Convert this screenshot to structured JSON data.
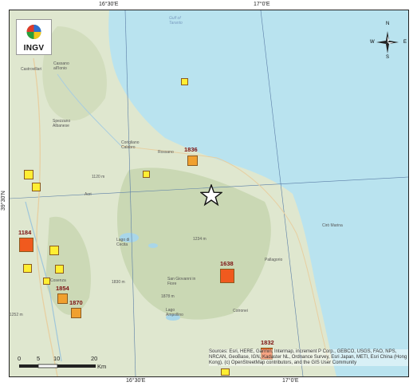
{
  "map": {
    "top_ticks": [
      "16°30'E",
      "17°0'E"
    ],
    "bottom_ticks": [
      "16°30'E",
      "17°0'E"
    ],
    "left_ticks": [
      "39°30'N"
    ]
  },
  "logo": {
    "text": "INGV"
  },
  "compass": {
    "n": "N",
    "s": "S",
    "e": "E",
    "w": "W"
  },
  "places": {
    "gulf": "Gulf of Taranto",
    "castrovillari": "Castrovillari",
    "cassano": "Cassano all'Ionio",
    "spezzano": "Spezzano Albanese",
    "corigliano": "Corigliano Calabro",
    "rossano": "Rossano",
    "acri": "Acri",
    "lago_cecita": "Lago di Cecita",
    "san_giovanni": "San Giovanni in Fiore",
    "cosenza": "Cosenza",
    "ciro_marina": "Cirò Marina",
    "pallagorio": "Pallagorio",
    "cotronei": "Cotronei",
    "ampollino": "Lago Ampollino",
    "elev_1120": "1120 m",
    "elev_1234": "1234 m",
    "elev_1830": "1830 m",
    "elev_1878": "1878 m",
    "elev_1252": "1252 m"
  },
  "earthquakes": [
    {
      "year": "1836",
      "color": "#f0a030"
    },
    {
      "year": "1184",
      "color": "#f05a1e"
    },
    {
      "year": "1638",
      "color": "#f05a1e"
    },
    {
      "year": "1854",
      "color": "#f0a030"
    },
    {
      "year": "1870",
      "color": "#f0a030"
    },
    {
      "year": "1832",
      "color": "#f05a1e"
    },
    {
      "year": "",
      "color": "#ffee33"
    },
    {
      "year": "",
      "color": "#ffee33"
    },
    {
      "year": "",
      "color": "#ffee33"
    },
    {
      "year": "",
      "color": "#ffee33"
    },
    {
      "year": "",
      "color": "#ffee33"
    },
    {
      "year": "",
      "color": "#ffee33"
    },
    {
      "year": "",
      "color": "#ffee33"
    },
    {
      "year": "",
      "color": "#ffee33"
    },
    {
      "year": "",
      "color": "#ffee33"
    }
  ],
  "scale": {
    "ticks": [
      "0",
      "5",
      "10",
      "20"
    ],
    "unit": "Km"
  },
  "attribution": "Sources: Esri, HERE, Garmin, Intermap, increment P Corp., GEBCO, USGS, FAO, NPS, NRCAN, GeoBase, IGN, Kadaster NL, Ordnance Survey, Esri Japan, METI, Esri China (Hong Kong), (c) OpenStreetMap contributors, and the GIS User Community",
  "colors": {
    "sea": "#b9e3ef",
    "land": "#dfe7cf",
    "highland": "#cad8b4",
    "major_quake": "#f05a1e",
    "medium_quake": "#f0a030",
    "minor_quake": "#ffee33"
  }
}
